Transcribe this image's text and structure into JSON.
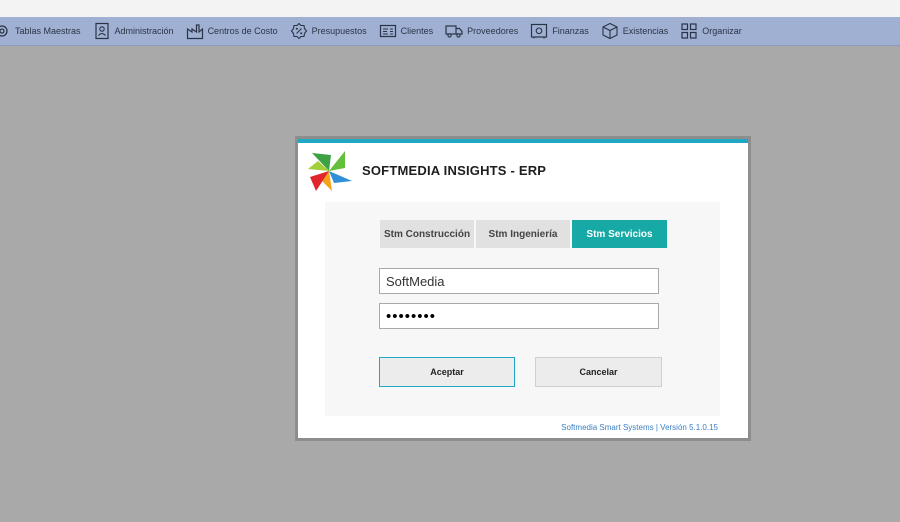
{
  "menu": {
    "items": [
      {
        "label": "Tablas Maestras",
        "icon": "gear-icon"
      },
      {
        "label": "Administración",
        "icon": "id-badge-icon"
      },
      {
        "label": "Centros de Costo",
        "icon": "factory-icon"
      },
      {
        "label": "Presupuestos",
        "icon": "percent-badge-icon"
      },
      {
        "label": "Clientes",
        "icon": "client-card-icon"
      },
      {
        "label": "Proveedores",
        "icon": "truck-icon"
      },
      {
        "label": "Finanzas",
        "icon": "safe-icon"
      },
      {
        "label": "Existencias",
        "icon": "box-icon"
      },
      {
        "label": "Organizar",
        "icon": "grid-icon"
      }
    ]
  },
  "login": {
    "title": "SOFTMEDIA INSIGHTS - ERP",
    "tabs": [
      {
        "label": "Stm Construcción",
        "active": false
      },
      {
        "label": "Stm Ingeniería",
        "active": false
      },
      {
        "label": "Stm Servicios",
        "active": true
      }
    ],
    "username": "SoftMedia",
    "password": "••••••••",
    "accept_label": "Aceptar",
    "cancel_label": "Cancelar",
    "version": "Softmedia Smart Systems | Versión 5.1.0.15"
  },
  "colors": {
    "menubar": "#9fb0d3",
    "desktop": "#a9a9a9",
    "accent": "#1fa7c4",
    "active_tab": "#16a9a5"
  }
}
